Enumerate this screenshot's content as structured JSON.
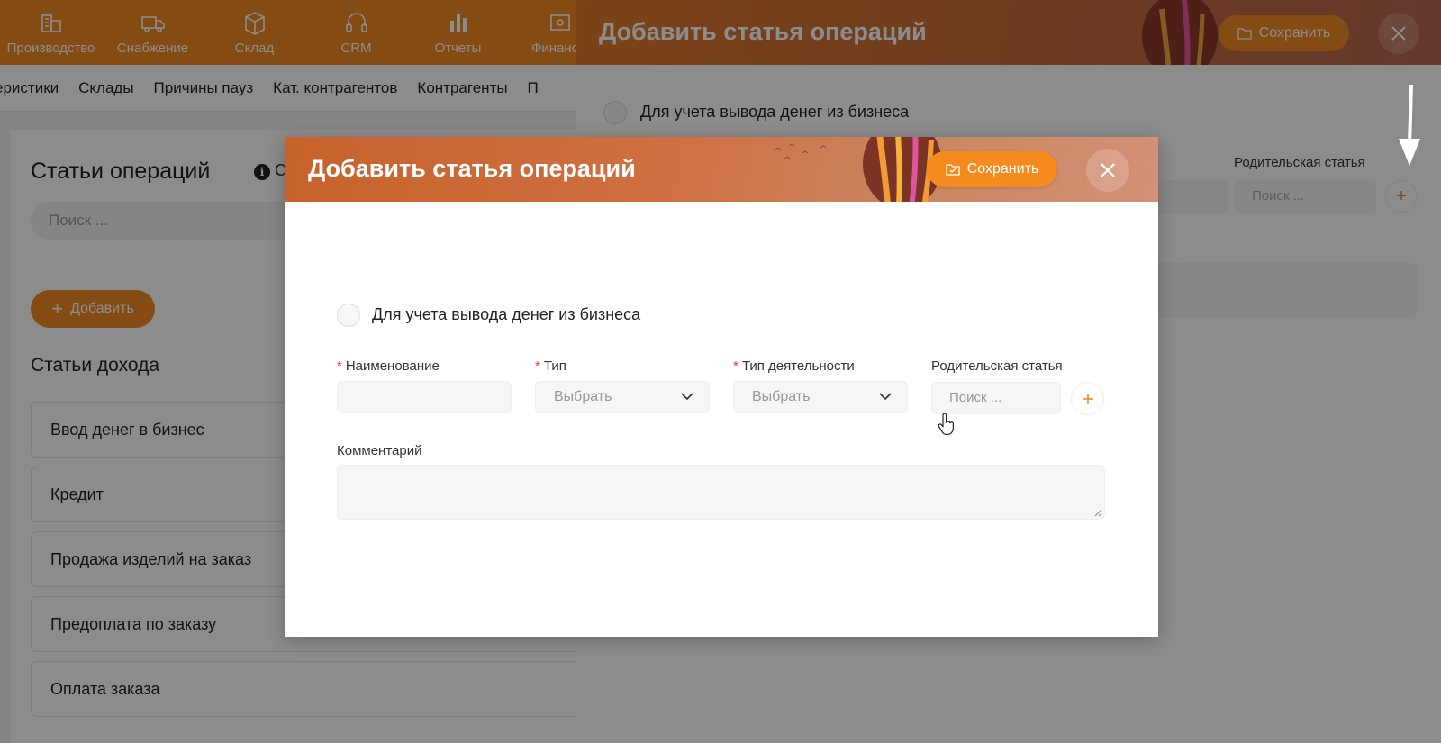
{
  "colors": {
    "accent": "#f08a24",
    "required": "#e53935"
  },
  "topnav": {
    "items": [
      {
        "label": "Производство",
        "icon": "factory-icon"
      },
      {
        "label": "Снабжение",
        "icon": "truck-icon"
      },
      {
        "label": "Склад",
        "icon": "box-icon"
      },
      {
        "label": "CRM",
        "icon": "headset-icon"
      },
      {
        "label": "Отчеты",
        "icon": "bar-chart-icon"
      },
      {
        "label": "Финансы",
        "icon": "finance-icon"
      }
    ]
  },
  "subnav": {
    "items": [
      "еристики",
      "Склады",
      "Причины пауз",
      "Кат. контрагентов",
      "Контрагенты",
      "П"
    ]
  },
  "page": {
    "title": "Статьи операций",
    "info_text": "С",
    "search_placeholder": "Поиск ...",
    "add_label": "Добавить",
    "income_title": "Статьи дохода",
    "income_items": [
      "Ввод денег в бизнес",
      "Кредит",
      "Продажа изделий на заказ",
      "Предоплата по заказу",
      "Оплата заказа"
    ]
  },
  "drawer": {
    "title": "Добавить статья операций",
    "save_label": "Сохранить",
    "radio_label": "Для учета вывода денег из бизнеса",
    "parent_label": "Родительская статья",
    "search_placeholder": "Поиск ..."
  },
  "modal": {
    "title": "Добавить статья операций",
    "save_label": "Сохранить",
    "radio_label": "Для учета вывода денег из бизнеса",
    "fields": {
      "name": {
        "label": "Наименование",
        "required": "*",
        "value": ""
      },
      "type": {
        "label": "Тип",
        "required": "*",
        "placeholder": "Выбрать"
      },
      "activity": {
        "label": "Тип деятельности",
        "required": "*",
        "placeholder": "Выбрать"
      },
      "parent": {
        "label": "Родительская статья",
        "placeholder": "Поиск ..."
      }
    },
    "comment_label": "Комментарий",
    "comment_value": ""
  }
}
